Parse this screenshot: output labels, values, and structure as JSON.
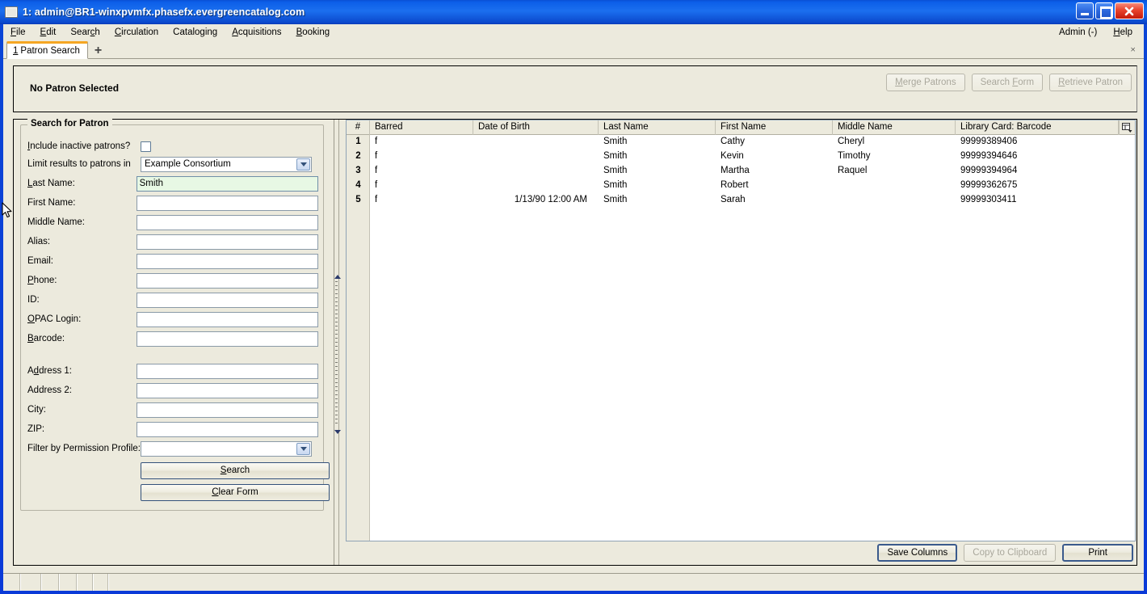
{
  "window": {
    "title": "1: admin@BR1-winxpvmfx.phasefx.evergreencatalog.com",
    "minimize_label": "Minimize",
    "maximize_label": "Maximize",
    "close_label": "Close"
  },
  "menubar": {
    "items": [
      {
        "label": "File",
        "mnemonic": "F"
      },
      {
        "label": "Edit",
        "mnemonic": "E"
      },
      {
        "label": "Search",
        "mnemonic": "c"
      },
      {
        "label": "Circulation",
        "mnemonic": "C"
      },
      {
        "label": "Cataloging",
        "mnemonic": "g"
      },
      {
        "label": "Acquisitions",
        "mnemonic": "A"
      },
      {
        "label": "Booking",
        "mnemonic": "B"
      }
    ],
    "right": [
      {
        "label": "Admin (-)"
      },
      {
        "label": "Help",
        "mnemonic": "H"
      }
    ]
  },
  "tabs": {
    "items": [
      {
        "number": "1",
        "label": "Patron Search"
      }
    ],
    "new_tab_label": "+",
    "close_label": "×"
  },
  "patron_bar": {
    "status": "No Patron Selected",
    "buttons": [
      {
        "label": "Merge Patrons",
        "enabled": false
      },
      {
        "label": "Search Form",
        "enabled": false
      },
      {
        "label": "Retrieve Patron",
        "enabled": false
      }
    ]
  },
  "search_form": {
    "legend": "Search for Patron",
    "include_inactive_label": "Include inactive patrons?",
    "include_inactive_checked": false,
    "limit_label": "Limit results to patrons in",
    "limit_value": "Example Consortium",
    "fields": [
      {
        "label": "Last Name:",
        "value": "Smith",
        "focused": true
      },
      {
        "label": "First Name:",
        "value": "",
        "focused": false
      },
      {
        "label": "Middle Name:",
        "value": "",
        "focused": false
      },
      {
        "label": "Alias:",
        "value": "",
        "focused": false
      },
      {
        "label": "Email:",
        "value": "",
        "focused": false
      },
      {
        "label": "Phone:",
        "value": "",
        "focused": false
      },
      {
        "label": "ID:",
        "value": "",
        "focused": false
      },
      {
        "label": "OPAC Login:",
        "value": "",
        "focused": false
      },
      {
        "label": "Barcode:",
        "value": "",
        "focused": false
      }
    ],
    "address_fields": [
      {
        "label": "Address 1:",
        "value": ""
      },
      {
        "label": "Address 2:",
        "value": ""
      },
      {
        "label": "City:",
        "value": ""
      },
      {
        "label": "ZIP:",
        "value": ""
      }
    ],
    "permission_label": "Filter by Permission Profile:",
    "permission_value": "",
    "search_button": "Search",
    "clear_button": "Clear Form"
  },
  "results": {
    "columns": [
      "#",
      "Barred",
      "Date of Birth",
      "Last Name",
      "First Name",
      "Middle Name",
      "Library Card: Barcode"
    ],
    "rows": [
      {
        "num": "1",
        "barred": "f",
        "dob": "",
        "last": "Smith",
        "first": "Cathy",
        "middle": "Cheryl",
        "barcode": "99999389406"
      },
      {
        "num": "2",
        "barred": "f",
        "dob": "",
        "last": "Smith",
        "first": "Kevin",
        "middle": "Timothy",
        "barcode": "99999394646"
      },
      {
        "num": "3",
        "barred": "f",
        "dob": "",
        "last": "Smith",
        "first": "Martha",
        "middle": "Raquel",
        "barcode": "99999394964"
      },
      {
        "num": "4",
        "barred": "f",
        "dob": "",
        "last": "Smith",
        "first": "Robert",
        "middle": "",
        "barcode": "99999362675"
      },
      {
        "num": "5",
        "barred": "f",
        "dob": "1/13/90 12:00 AM",
        "last": "Smith",
        "first": "Sarah",
        "middle": "",
        "barcode": "99999303411"
      }
    ],
    "footer_buttons": [
      {
        "label": "Save Columns",
        "enabled": true,
        "default": true
      },
      {
        "label": "Copy to Clipboard",
        "enabled": false,
        "default": false
      },
      {
        "label": "Print",
        "enabled": true,
        "default": true
      }
    ],
    "column_picker_icon": "column-picker-icon"
  },
  "colors": {
    "titlebar_blue": "#0c5ee8",
    "chrome_beige": "#eceadd",
    "focus_green": "#e7f8e4",
    "tab_accent": "#f5a623"
  }
}
